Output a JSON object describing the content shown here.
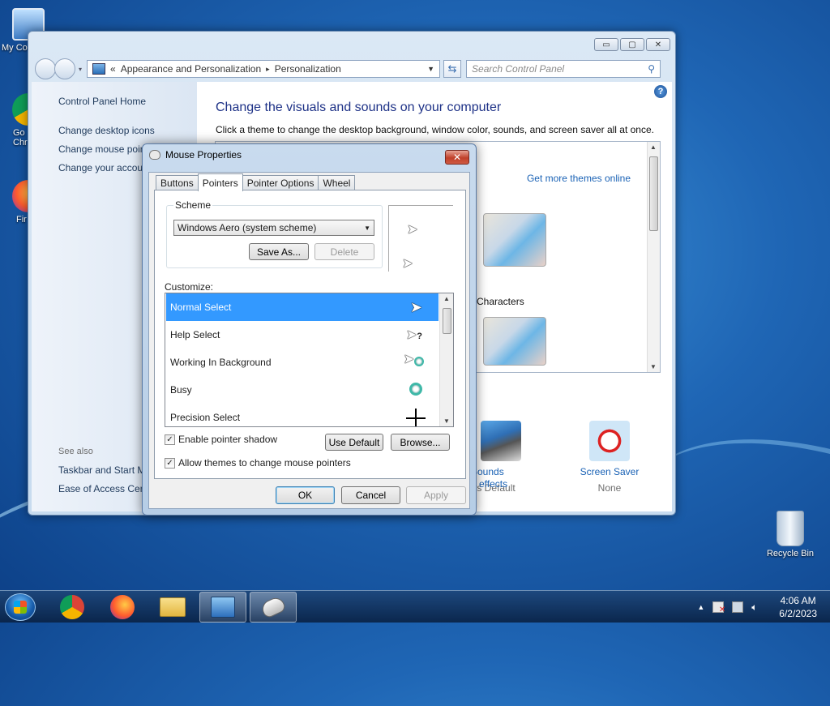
{
  "desktop": {
    "icons": [
      {
        "label": "My Co"
      },
      {
        "label": "Go\nChr"
      },
      {
        "label": "Fir"
      },
      {
        "label": "Recycle Bin"
      }
    ]
  },
  "control_panel": {
    "breadcrumb_prefix": "«",
    "breadcrumb": [
      "Appearance and Personalization",
      "Personalization"
    ],
    "breadcrumb_sep": "▸",
    "search_placeholder": "Search Control Panel",
    "sidebar": {
      "home": "Control Panel Home",
      "links": [
        "Change desktop icons",
        "Change mouse poir",
        "Change your accou"
      ],
      "see_also": "See also",
      "see_also_links": [
        "Taskbar and Start M",
        "Ease of Access Cent"
      ]
    },
    "title": "Change the visuals and sounds on your computer",
    "subtitle": "Click a theme to change the desktop background, window color, sounds, and screen saver all at once.",
    "more_themes": "Get more themes online",
    "theme_label": "Characters",
    "bottom": [
      {
        "label": "Sounds",
        "sub": "ows Default"
      },
      {
        "label": "Screen Saver",
        "sub": "None"
      }
    ],
    "effects_link": "effects"
  },
  "mouse_properties": {
    "title": "Mouse Properties",
    "close": "✕",
    "tabs": [
      "Buttons",
      "Pointers",
      "Pointer Options",
      "Wheel"
    ],
    "active_tab": "Pointers",
    "scheme_label": "Scheme",
    "scheme_value": "Windows Aero (system scheme)",
    "save_as": "Save As...",
    "delete": "Delete",
    "customize_label": "Customize:",
    "pointer_list": [
      {
        "name": "Normal Select",
        "selected": true
      },
      {
        "name": "Help Select",
        "selected": false
      },
      {
        "name": "Working In Background",
        "selected": false
      },
      {
        "name": "Busy",
        "selected": false
      },
      {
        "name": "Precision Select",
        "selected": false
      }
    ],
    "enable_shadow": {
      "label": "Enable pointer shadow",
      "checked": true
    },
    "allow_themes": {
      "label": "Allow themes to change mouse pointers",
      "checked": true
    },
    "use_default": "Use Default",
    "browse": "Browse...",
    "ok": "OK",
    "cancel": "Cancel",
    "apply": "Apply"
  },
  "taskbar": {
    "time": "4:06 AM",
    "date": "6/2/2023"
  }
}
